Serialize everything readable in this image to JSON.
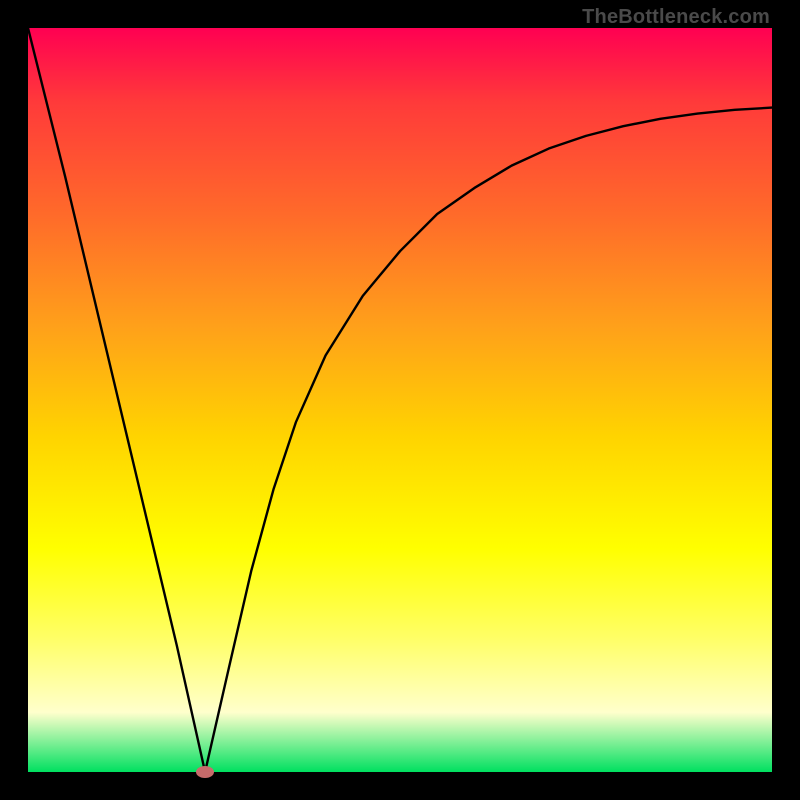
{
  "attribution": "TheBottleneck.com",
  "chart_data": {
    "type": "line",
    "title": "",
    "xlabel": "",
    "ylabel": "",
    "xlim": [
      0,
      100
    ],
    "ylim": [
      0,
      100
    ],
    "grid": false,
    "legend": false,
    "series": [
      {
        "name": "bottleneck-curve",
        "x": [
          0,
          5,
          10,
          15,
          20,
          23.8,
          27,
          30,
          33,
          36,
          40,
          45,
          50,
          55,
          60,
          65,
          70,
          75,
          80,
          85,
          90,
          95,
          100
        ],
        "y": [
          100,
          80,
          59,
          38,
          17,
          0,
          14,
          27,
          38,
          47,
          56,
          64,
          70,
          75,
          78.5,
          81.5,
          83.8,
          85.5,
          86.8,
          87.8,
          88.5,
          89,
          89.3
        ]
      }
    ],
    "marker": {
      "x": 23.8,
      "y": 0
    },
    "background_gradient": {
      "direction": "vertical",
      "stops": [
        {
          "pos": 0.0,
          "color": "#ff0052"
        },
        {
          "pos": 0.55,
          "color": "#ffd400"
        },
        {
          "pos": 0.92,
          "color": "#ffffcc"
        },
        {
          "pos": 1.0,
          "color": "#00e060"
        }
      ]
    }
  }
}
